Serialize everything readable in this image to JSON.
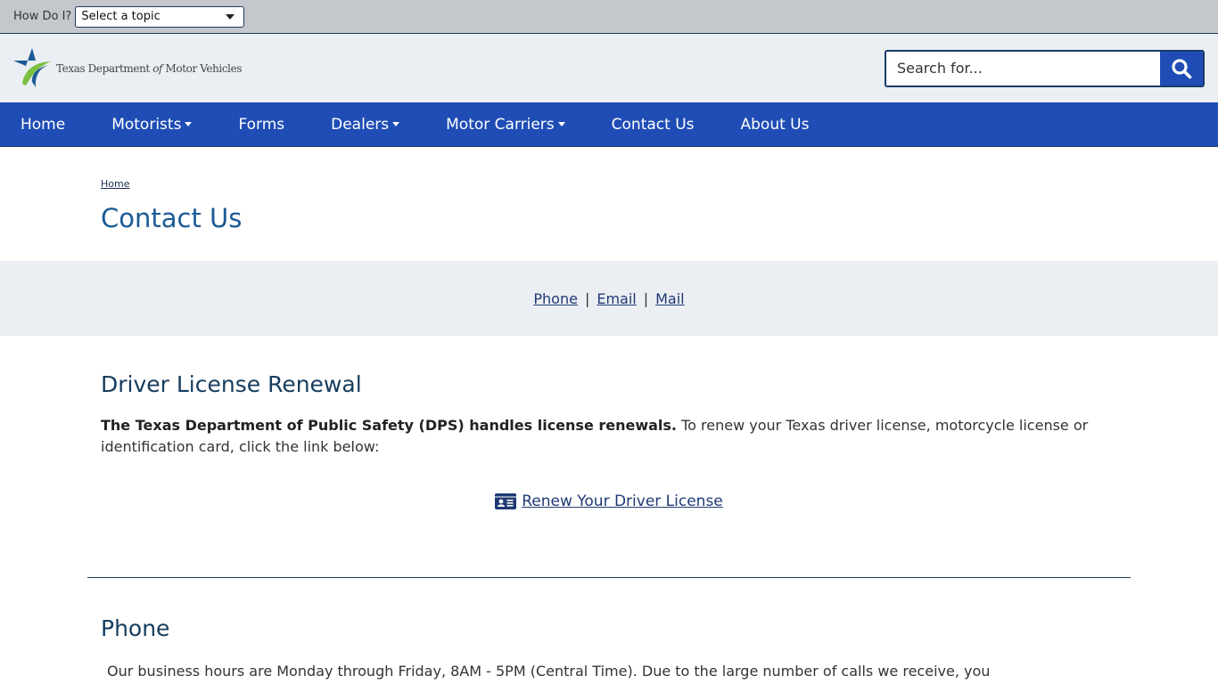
{
  "topbar": {
    "how_do_i_label": "How Do I?",
    "topic_select_value": "Select a topic"
  },
  "header": {
    "logo_text_prefix": "Texas Department ",
    "logo_text_of": "of",
    "logo_text_suffix": " Motor Vehicles",
    "search_placeholder": "Search for...",
    "search_icon": "search-icon",
    "colors": {
      "brand_blue": "#1f4db5",
      "logo_green": "#7bc043",
      "logo_navy": "#1b5a96"
    }
  },
  "nav": {
    "items": [
      {
        "label": "Home",
        "dropdown": false
      },
      {
        "label": "Motorists",
        "dropdown": true
      },
      {
        "label": "Forms",
        "dropdown": false
      },
      {
        "label": "Dealers",
        "dropdown": true
      },
      {
        "label": "Motor Carriers",
        "dropdown": true
      },
      {
        "label": "Contact Us",
        "dropdown": false
      },
      {
        "label": "About Us",
        "dropdown": false
      }
    ]
  },
  "breadcrumb": {
    "home": "Home"
  },
  "page_title": "Contact Us",
  "jump_links": {
    "phone": "Phone",
    "email": "Email",
    "mail": "Mail",
    "separator": "|"
  },
  "renewal": {
    "heading": "Driver License Renewal",
    "bold_text": "The Texas Department of Public Safety (DPS) handles license renewals.",
    "body_text": " To renew your Texas driver license, motorcycle license or identification card, click the link below:",
    "link_label": "Renew Your Driver License",
    "link_icon": "id-card-icon"
  },
  "phone": {
    "heading": "Phone",
    "body_text": "Our business hours are Monday through Friday, 8AM - 5PM (Central Time). Due to the large number of calls we receive, you"
  }
}
